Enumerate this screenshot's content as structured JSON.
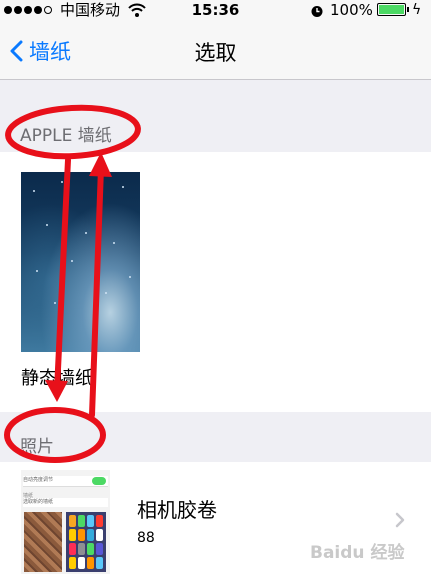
{
  "status_bar": {
    "carrier": "中国移动",
    "time": "15:36",
    "battery_percent": "100%",
    "battery_color": "#4cd964"
  },
  "nav": {
    "back_label": "墙纸",
    "title": "选取",
    "accent_color": "#0a7aff"
  },
  "sections": {
    "apple_header": "APPLE 墙纸",
    "photos_header": "照片"
  },
  "apple_wallpaper": {
    "label": "静态墙纸"
  },
  "camera_roll": {
    "title": "相机胶卷",
    "count": "88",
    "thumb_text_1": "自动亮度调节",
    "thumb_text_2": "墙纸",
    "thumb_text_3": "选取新的墙纸"
  },
  "annotations": {
    "color": "#e8101a"
  },
  "watermark": {
    "text": "Baidu 经验"
  }
}
